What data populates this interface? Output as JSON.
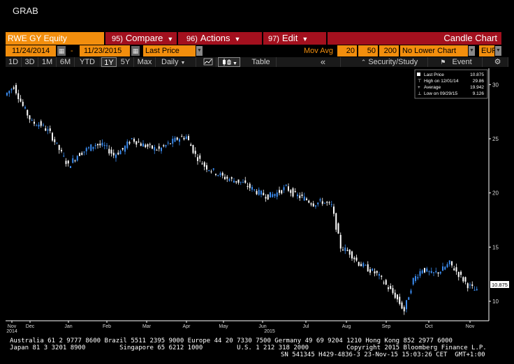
{
  "window": {
    "title": "GRAB"
  },
  "toolbar": {
    "ticker": "RWE GY Equity",
    "compare": {
      "num": "95)",
      "label": "Compare"
    },
    "actions": {
      "num": "96)",
      "label": "Actions"
    },
    "edit": {
      "num": "97)",
      "label": "Edit"
    },
    "chart_type": "Candle Chart"
  },
  "settings": {
    "start_date": "11/24/2014",
    "separator": "-",
    "end_date": "11/23/2015",
    "field": "Last Price",
    "mov_avg_label": "Mov Avg",
    "mov_avg": [
      "20",
      "50",
      "200"
    ],
    "lower_chart": "No Lower Chart",
    "currency": "EUR"
  },
  "periods": [
    "1D",
    "3D",
    "1M",
    "6M",
    "YTD",
    "1Y",
    "5Y",
    "Max"
  ],
  "selected_period": "1Y",
  "frequency": "Daily",
  "table_label": "Table",
  "nav_left": "«",
  "security_study": "Security/Study",
  "event_label": "Event",
  "legend": {
    "rows": [
      {
        "label": "Last Price",
        "value": "10.875"
      },
      {
        "label": "High on 12/01/14",
        "value": "29.86"
      },
      {
        "label": "Average",
        "value": "19.942"
      },
      {
        "label": "Low on 09/29/15",
        "value": "9.126"
      }
    ]
  },
  "last_price_tag": "10.875",
  "chart_data": {
    "type": "candlestick",
    "title": "",
    "series": [
      {
        "name": "Last Price"
      }
    ],
    "x": [
      "2014-11-24",
      "2014-12-01",
      "2014-12-08",
      "2014-12-15",
      "2014-12-22",
      "2014-12-29",
      "2015-01-05",
      "2015-01-12",
      "2015-01-19",
      "2015-01-26",
      "2015-02-02",
      "2015-02-09",
      "2015-02-16",
      "2015-02-23",
      "2015-03-02",
      "2015-03-09",
      "2015-03-16",
      "2015-03-23",
      "2015-03-30",
      "2015-04-06",
      "2015-04-13",
      "2015-04-20",
      "2015-04-27",
      "2015-05-04",
      "2015-05-11",
      "2015-05-18",
      "2015-05-25",
      "2015-06-01",
      "2015-06-08",
      "2015-06-15",
      "2015-06-22",
      "2015-06-29",
      "2015-07-06",
      "2015-07-13",
      "2015-07-20",
      "2015-07-27",
      "2015-08-03",
      "2015-08-10",
      "2015-08-17",
      "2015-08-24",
      "2015-08-31",
      "2015-09-07",
      "2015-09-14",
      "2015-09-21",
      "2015-09-28",
      "2015-10-05",
      "2015-10-12",
      "2015-10-19",
      "2015-10-26",
      "2015-11-02",
      "2015-11-09",
      "2015-11-16",
      "2015-11-23"
    ],
    "y": [
      29.0,
      29.86,
      28.0,
      26.5,
      26.3,
      25.5,
      24.0,
      22.5,
      23.5,
      24.0,
      24.5,
      24.3,
      23.5,
      24.0,
      25.0,
      24.5,
      24.2,
      24.0,
      24.5,
      25.0,
      25.2,
      23.5,
      22.5,
      22.0,
      21.5,
      21.2,
      21.0,
      20.5,
      20.0,
      19.7,
      20.0,
      20.5,
      19.8,
      19.5,
      19.0,
      19.2,
      18.8,
      15.0,
      14.5,
      13.5,
      13.0,
      12.5,
      11.5,
      10.5,
      9.126,
      12.0,
      13.0,
      12.5,
      12.8,
      13.5,
      12.5,
      11.5,
      10.875
    ],
    "x_tick_labels": [
      "Nov",
      "Dec",
      "Jan",
      "Feb",
      "Mar",
      "Apr",
      "May",
      "Jun",
      "Jul",
      "Aug",
      "Sep",
      "Oct",
      "Nov"
    ],
    "x_year_labels": [
      {
        "under": "Nov",
        "text": "2014"
      },
      {
        "under": "Jun",
        "text": "2015"
      }
    ],
    "y_ticks": [
      10,
      15,
      20,
      25,
      30
    ],
    "ylim": [
      8.2,
      31.5
    ],
    "grid": false,
    "legend_position": "top-right",
    "colors": {
      "up": "#3b8cf0",
      "down": "#ffffff",
      "background": "#000000",
      "axis": "#ffffff"
    }
  },
  "footer": {
    "line1": "Australia 61 2 9777 8600 Brazil 5511 2395 9000 Europe 44 20 7330 7500 Germany 49 69 9204 1210 Hong Kong 852 2977 6000",
    "line2": "Japan 81 3 3201 8900         Singapore 65 6212 1000         U.S. 1 212 318 2000          Copyright 2015 Bloomberg Finance L.P.",
    "line3": "SN 541345 H429-4836-3 23-Nov-15 15:03:26 CET  GMT+1:00"
  }
}
